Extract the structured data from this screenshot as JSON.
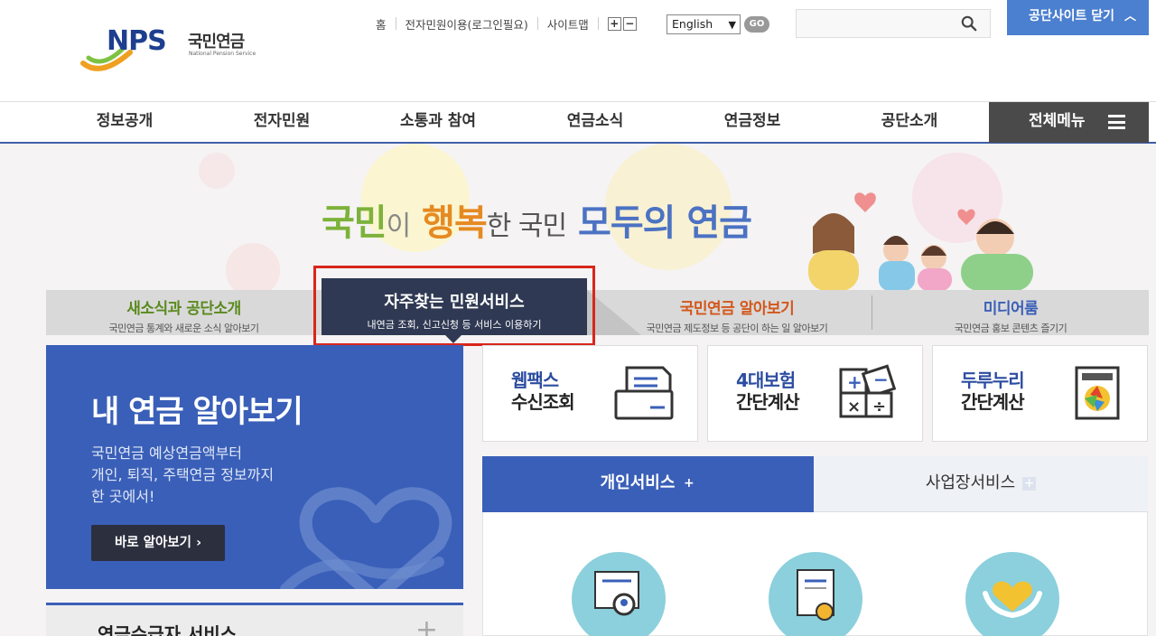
{
  "header": {
    "logo_text": "NPS",
    "logo_kr": "국민연금",
    "logo_en": "National Pension Service",
    "util_links": [
      "홈",
      "전자민원이용(로그인필요)",
      "사이트맵"
    ],
    "font_plus": "+",
    "font_minus": "−",
    "language": "English",
    "go_label": "GO",
    "search_placeholder": "",
    "close_site_label": "공단사이트 닫기"
  },
  "gnb": {
    "items": [
      "정보공개",
      "전자민원",
      "소통과 참여",
      "연금소식",
      "연금정보",
      "공단소개"
    ],
    "all_menu": "전체메뉴"
  },
  "hero": {
    "slogan": [
      "국민",
      "이",
      "행복",
      "한 국민",
      "모두의 연금"
    ]
  },
  "tabs": [
    {
      "title": "새소식과 공단소개",
      "sub": "국민연금 통계와 새로운 소식 알아보기",
      "color": "#5a8a1e"
    },
    {
      "title": "자주찾는 민원서비스",
      "sub": "내연금 조회, 신고신청 등 서비스 이용하기",
      "color": "#ffffff"
    },
    {
      "title": "국민연금 알아보기",
      "sub": "국민연금 제도정보 등 공단이 하는 일 알아보기",
      "color": "#d3571b"
    },
    {
      "title": "미디어룸",
      "sub": "국민연금 홍보 콘텐츠 즐기기",
      "color": "#3a5fb8"
    }
  ],
  "my_card": {
    "title": "내 연금 알아보기",
    "desc": [
      "국민연금 예상연금액부터",
      "개인, 퇴직, 주택연금 정보까지",
      "한 곳에서!"
    ],
    "button": "바로 알아보기 ›"
  },
  "recv_panel": {
    "title": "연금수급자 서비스",
    "plus": "+"
  },
  "quick": [
    {
      "t1": "웹팩스",
      "t2": "수신조회",
      "icon": "fax-icon"
    },
    {
      "t1": "4대보험",
      "t2": "간단계산",
      "icon": "calculator-icon"
    },
    {
      "t1": "두루누리",
      "t2": "간단계산",
      "icon": "durunuri-icon"
    }
  ],
  "svc_tabs": {
    "personal": "개인서비스",
    "business": "사업장서비스",
    "plus": "+"
  },
  "colors": {
    "brand_blue": "#3a5fb8",
    "nav_dark": "#2f3953",
    "highlight": "#d9261c"
  }
}
